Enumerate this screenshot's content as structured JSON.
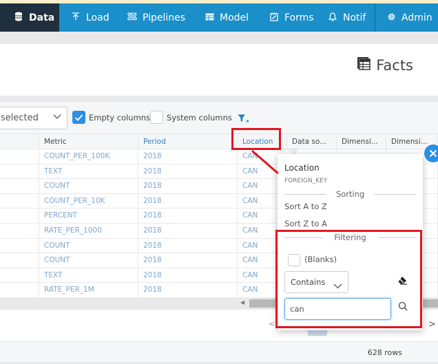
{
  "nav": {
    "items": [
      {
        "label": "Data",
        "icon": "database-icon",
        "active": true
      },
      {
        "label": "Load",
        "icon": "upload-icon",
        "active": false
      },
      {
        "label": "Pipelines",
        "icon": "pipelines-icon",
        "active": false
      },
      {
        "label": "Model",
        "icon": "table-model-icon",
        "active": false
      },
      {
        "label": "Forms",
        "icon": "forms-icon",
        "active": false
      },
      {
        "label": "Notif",
        "icon": "bell-icon",
        "active": false
      },
      {
        "label": "Admin",
        "icon": "gear-icon",
        "active": false
      }
    ]
  },
  "page": {
    "title": "Facts",
    "title_icon": "table-icon"
  },
  "toolbar": {
    "column_select_value": "selected",
    "empty_columns_label": "Empty columns",
    "empty_columns_checked": true,
    "system_columns_label": "System columns",
    "system_columns_checked": false,
    "clear_filters_icon": "filter-clear-icon"
  },
  "grid": {
    "columns": [
      "",
      "Metric",
      "Period",
      "Location",
      "Data so...",
      "Dimensi...",
      "Dimensi..."
    ],
    "rows": [
      {
        "metric": "COUNT_PER_100K",
        "period": "2018",
        "location": "CAN"
      },
      {
        "metric": "TEXT",
        "period": "2018",
        "location": "CAN"
      },
      {
        "metric": "COUNT",
        "period": "2018",
        "location": "CAN"
      },
      {
        "metric": "COUNT_PER_10K",
        "period": "2018",
        "location": "CAN"
      },
      {
        "metric": "PERCENT",
        "period": "2018",
        "location": "CAN"
      },
      {
        "metric": "RATE_PER_1000",
        "period": "2018",
        "location": "CAN"
      },
      {
        "metric": "COUNT",
        "period": "2018",
        "location": "CAN"
      },
      {
        "metric": "COUNT",
        "period": "2018",
        "location": "CAN"
      },
      {
        "metric": "TEXT",
        "period": "2018",
        "location": "CAN"
      },
      {
        "metric": "RATE_PER_1M",
        "period": "2018",
        "location": "CAN"
      }
    ]
  },
  "pager": {
    "prev_label": "<<",
    "next_label": ">"
  },
  "footer": {
    "row_count": "628 rows"
  },
  "popup": {
    "column_name": "Location",
    "column_type": "FOREIGN_KEY",
    "sorting_label": "Sorting",
    "sort_asc": "Sort A to Z",
    "sort_desc": "Sort Z to A",
    "filtering_label": "Filtering",
    "blanks_label": "(Blanks)",
    "blanks_checked": false,
    "operator": "Contains",
    "filter_value": "can",
    "close_icon": "close-icon"
  },
  "colors": {
    "nav_bg": "#1a8fc9",
    "nav_active_bg": "#1f2f3d",
    "annotation_red": "#e0161f",
    "accent_blue": "#2b8fe6",
    "cell_text": "#7fa7cf"
  }
}
